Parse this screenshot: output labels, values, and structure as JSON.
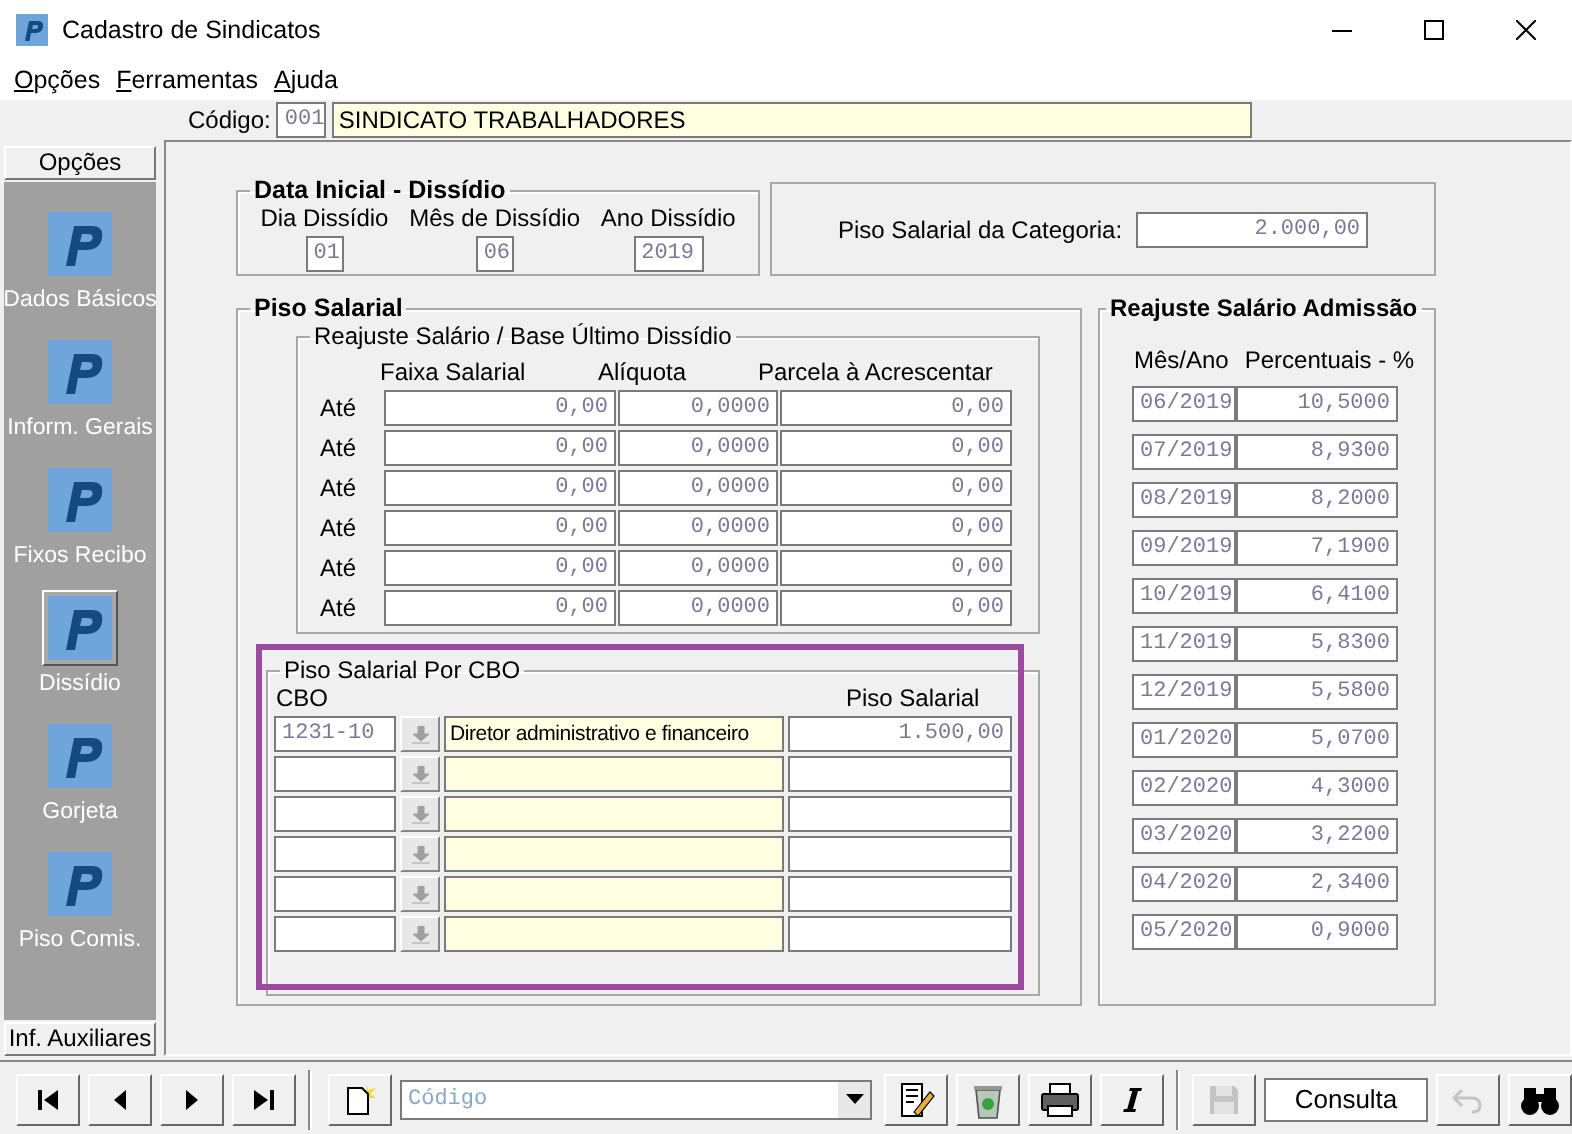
{
  "window": {
    "title": "Cadastro de Sindicatos"
  },
  "menu": [
    {
      "label": "Opções"
    },
    {
      "label": "Ferramentas"
    },
    {
      "label": "Ajuda"
    }
  ],
  "codigo": {
    "label": "Código:",
    "code": "001",
    "name": "SINDICATO TRABALHADORES"
  },
  "sidebar": {
    "header": "Opções",
    "footer": "Inf. Auxiliares",
    "items": [
      {
        "label": "Dados Básicos",
        "selected": false
      },
      {
        "label": "Inform. Gerais",
        "selected": false
      },
      {
        "label": "Fixos Recibo",
        "selected": false
      },
      {
        "label": "Dissídio",
        "selected": true
      },
      {
        "label": "Gorjeta",
        "selected": false
      },
      {
        "label": "Piso Comis.",
        "selected": false
      }
    ]
  },
  "data_inicial": {
    "title": "Data Inicial - Dissídio",
    "fields": [
      {
        "label": "Dia Dissídio",
        "value": "01"
      },
      {
        "label": "Mês de Dissídio",
        "value": "06"
      },
      {
        "label": "Ano Dissídio",
        "value": "2019"
      }
    ]
  },
  "piso_categoria": {
    "label": "Piso Salarial da Categoria:",
    "value": "2.000,00"
  },
  "piso_salarial": {
    "title": "Piso Salarial",
    "reajuste": {
      "title": "Reajuste Salário / Base Último Dissídio",
      "columns": [
        "Faixa Salarial",
        "Alíquota",
        "Parcela à Acrescentar"
      ],
      "rows": [
        {
          "label": "Até",
          "faixa": "0,00",
          "aliquota": "0,0000",
          "parcela": "0,00"
        },
        {
          "label": "Até",
          "faixa": "0,00",
          "aliquota": "0,0000",
          "parcela": "0,00"
        },
        {
          "label": "Até",
          "faixa": "0,00",
          "aliquota": "0,0000",
          "parcela": "0,00"
        },
        {
          "label": "Até",
          "faixa": "0,00",
          "aliquota": "0,0000",
          "parcela": "0,00"
        },
        {
          "label": "Até",
          "faixa": "0,00",
          "aliquota": "0,0000",
          "parcela": "0,00"
        },
        {
          "label": "Até",
          "faixa": "0,00",
          "aliquota": "0,0000",
          "parcela": "0,00"
        }
      ]
    },
    "cbo": {
      "title": "Piso Salarial Por CBO",
      "columns": [
        "CBO",
        "Piso Salarial"
      ],
      "highlighted": true,
      "rows": [
        {
          "cbo": "1231-10",
          "description": "Diretor administrativo e financeiro",
          "piso": "1.500,00"
        },
        {},
        {},
        {},
        {},
        {}
      ]
    }
  },
  "reajuste_admissao": {
    "title": "Reajuste Salário Admissão",
    "columns": [
      "Mês/Ano",
      "Percentuais - %"
    ],
    "rows": [
      {
        "month": "06/2019",
        "percent": "10,5000"
      },
      {
        "month": "07/2019",
        "percent": "8,9300"
      },
      {
        "month": "08/2019",
        "percent": "8,2000"
      },
      {
        "month": "09/2019",
        "percent": "7,1900"
      },
      {
        "month": "10/2019",
        "percent": "6,4100"
      },
      {
        "month": "11/2019",
        "percent": "5,8300"
      },
      {
        "month": "12/2019",
        "percent": "5,5800"
      },
      {
        "month": "01/2020",
        "percent": "5,0700"
      },
      {
        "month": "02/2020",
        "percent": "4,3000"
      },
      {
        "month": "03/2020",
        "percent": "3,2200"
      },
      {
        "month": "04/2020",
        "percent": "2,3400"
      },
      {
        "month": "05/2020",
        "percent": "0,9000"
      }
    ]
  },
  "toolbar": {
    "buttons": [
      {
        "kind": "first",
        "disabled": false
      },
      {
        "kind": "prev",
        "disabled": false
      },
      {
        "kind": "next",
        "disabled": false
      },
      {
        "kind": "last",
        "disabled": false
      },
      {
        "kind": "new",
        "disabled": false
      },
      {
        "kind": "search"
      },
      {
        "kind": "edit",
        "disabled": false
      },
      {
        "kind": "delete",
        "disabled": false
      },
      {
        "kind": "print",
        "disabled": false
      },
      {
        "kind": "italic",
        "disabled": false
      },
      {
        "kind": "save",
        "disabled": true
      },
      {
        "kind": "mode"
      },
      {
        "kind": "undo",
        "disabled": true
      },
      {
        "kind": "find",
        "disabled": false
      }
    ],
    "search_placeholder": "Código",
    "mode": "Consulta"
  }
}
